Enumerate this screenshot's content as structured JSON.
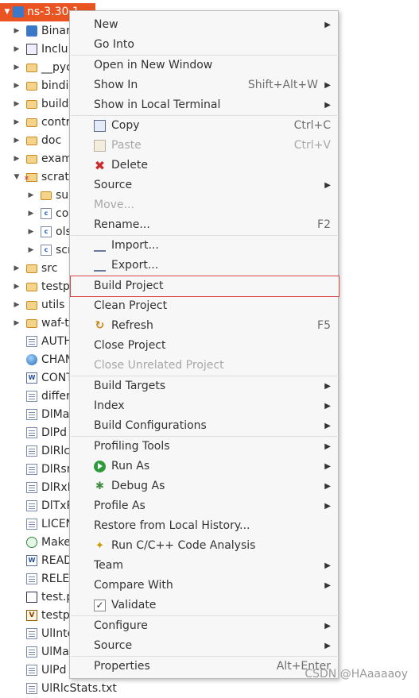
{
  "tree": {
    "project": "ns-3.30.1",
    "items": [
      {
        "label": "Binar",
        "icon": "binaries-icon",
        "arrow": "▶"
      },
      {
        "label": "Inclu",
        "icon": "includes-icon",
        "arrow": "▶"
      },
      {
        "label": "__pyc",
        "icon": "folder-icon",
        "arrow": "▶"
      },
      {
        "label": "bindi",
        "icon": "folder-icon",
        "arrow": "▶"
      },
      {
        "label": "build",
        "icon": "folder-icon",
        "arrow": "▶"
      },
      {
        "label": "contr",
        "icon": "folder-icon",
        "arrow": "▶"
      },
      {
        "label": "doc",
        "icon": "folder-icon",
        "arrow": "▶"
      },
      {
        "label": "exam",
        "icon": "folder-icon",
        "arrow": "▶"
      },
      {
        "label": "scrat",
        "icon": "error-folder-icon",
        "arrow": "▼"
      },
      {
        "label": "su",
        "icon": "folder-icon",
        "arrow": "▶"
      },
      {
        "label": "co",
        "icon": "c-source-error-icon",
        "arrow": "▶"
      },
      {
        "label": "ols",
        "icon": "c-source-error-icon",
        "arrow": "▶"
      },
      {
        "label": "scr",
        "icon": "c-source-icon",
        "arrow": "▶"
      },
      {
        "label": "src",
        "icon": "folder-icon",
        "arrow": "▶"
      },
      {
        "label": "testp",
        "icon": "folder-icon",
        "arrow": "▶"
      },
      {
        "label": "utils",
        "icon": "folder-icon",
        "arrow": "▶"
      },
      {
        "label": "waf-t",
        "icon": "folder-icon",
        "arrow": "▶"
      },
      {
        "label": "AUTH",
        "icon": "text-file-icon",
        "arrow": ""
      },
      {
        "label": "CHAN",
        "icon": "web-file-icon",
        "arrow": ""
      },
      {
        "label": "CONT",
        "icon": "word-doc-icon",
        "arrow": ""
      },
      {
        "label": "differ",
        "icon": "text-file-icon",
        "arrow": ""
      },
      {
        "label": "DlMa",
        "icon": "text-file-icon",
        "arrow": ""
      },
      {
        "label": "DlPd",
        "icon": "text-file-icon",
        "arrow": ""
      },
      {
        "label": "DlRlc",
        "icon": "text-file-icon",
        "arrow": ""
      },
      {
        "label": "DlRsr",
        "icon": "text-file-icon",
        "arrow": ""
      },
      {
        "label": "DlRxP",
        "icon": "text-file-icon",
        "arrow": ""
      },
      {
        "label": "DlTxP",
        "icon": "text-file-icon",
        "arrow": ""
      },
      {
        "label": "LICEN",
        "icon": "text-file-icon",
        "arrow": ""
      },
      {
        "label": "Make",
        "icon": "makefile-icon",
        "arrow": ""
      },
      {
        "label": "READ",
        "icon": "word-doc-icon",
        "arrow": ""
      },
      {
        "label": "RELE",
        "icon": "text-file-icon",
        "arrow": ""
      },
      {
        "label": "test.p",
        "icon": "python-file-icon",
        "arrow": ""
      },
      {
        "label": "testp",
        "icon": "v-file-icon",
        "arrow": ""
      },
      {
        "label": "UlInte",
        "icon": "text-file-icon",
        "arrow": ""
      },
      {
        "label": "UlMa",
        "icon": "text-file-icon",
        "arrow": ""
      },
      {
        "label": "UlPd",
        "icon": "text-file-icon",
        "arrow": ""
      },
      {
        "label": "UlRlcStats.txt",
        "icon": "text-file-icon",
        "arrow": ""
      }
    ]
  },
  "menu": {
    "items": [
      {
        "label": "New",
        "submenu": true
      },
      {
        "label": "Go Into"
      },
      {
        "sep": true
      },
      {
        "label": "Open in New Window"
      },
      {
        "label": "Show In",
        "accel": "Shift+Alt+W",
        "submenu": true
      },
      {
        "label": "Show in Local Terminal",
        "submenu": true
      },
      {
        "sep": true
      },
      {
        "label": "Copy",
        "accel": "Ctrl+C",
        "icon": "copy-icon"
      },
      {
        "label": "Paste",
        "accel": "Ctrl+V",
        "icon": "paste-icon",
        "disabled": true
      },
      {
        "label": "Delete",
        "icon": "delete-icon"
      },
      {
        "label": "Source",
        "submenu": true
      },
      {
        "label": "Move...",
        "disabled": true
      },
      {
        "label": "Rename...",
        "accel": "F2"
      },
      {
        "sep": true
      },
      {
        "label": "Import...",
        "icon": "import-icon"
      },
      {
        "label": "Export...",
        "icon": "export-icon"
      },
      {
        "sep": true
      },
      {
        "label": "Build Project",
        "highlight": true
      },
      {
        "label": "Clean Project"
      },
      {
        "label": "Refresh",
        "accel": "F5",
        "icon": "refresh-icon"
      },
      {
        "label": "Close Project"
      },
      {
        "label": "Close Unrelated Project",
        "disabled": true
      },
      {
        "sep": true
      },
      {
        "label": "Build Targets",
        "submenu": true
      },
      {
        "label": "Index",
        "submenu": true
      },
      {
        "label": "Build Configurations",
        "submenu": true
      },
      {
        "sep": true
      },
      {
        "label": "Profiling Tools",
        "submenu": true
      },
      {
        "label": "Run As",
        "icon": "run-icon",
        "submenu": true
      },
      {
        "label": "Debug As",
        "icon": "debug-icon",
        "submenu": true
      },
      {
        "label": "Profile As",
        "submenu": true
      },
      {
        "label": "Restore from Local History..."
      },
      {
        "label": "Run C/C++ Code Analysis",
        "icon": "code-analysis-icon"
      },
      {
        "label": "Team",
        "submenu": true
      },
      {
        "label": "Compare With",
        "submenu": true
      },
      {
        "label": "Validate",
        "icon": "validate-check-icon"
      },
      {
        "sep": true
      },
      {
        "label": "Configure",
        "submenu": true
      },
      {
        "label": "Source",
        "submenu": true
      },
      {
        "sep": true
      },
      {
        "label": "Properties",
        "accel": "Alt+Enter"
      }
    ]
  },
  "watermark": "CSDN @HAaaaaoy",
  "colors": {
    "selection": "#e95420",
    "highlight_border": "#d64545"
  }
}
